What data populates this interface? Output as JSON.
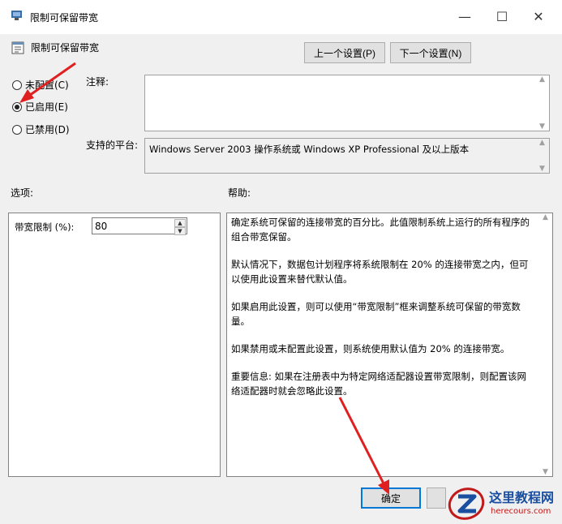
{
  "window": {
    "title": "限制可保留带宽",
    "minimize": "—",
    "maximize": "☐",
    "close": "✕"
  },
  "header": {
    "policy_title": "限制可保留带宽",
    "prev_label": "上一个设置(P)",
    "next_label": "下一个设置(N)"
  },
  "state": {
    "options": [
      {
        "label": "未配置(C)",
        "checked": false
      },
      {
        "label": "已启用(E)",
        "checked": true
      },
      {
        "label": "已禁用(D)",
        "checked": false
      }
    ]
  },
  "comment": {
    "label": "注释:",
    "value": ""
  },
  "platform": {
    "label": "支持的平台:",
    "value": "Windows Server 2003 操作系统或 Windows XP Professional 及以上版本"
  },
  "options_section": {
    "label": "选项:",
    "bandwidth_label": "带宽限制 (%):",
    "bandwidth_value": "80"
  },
  "help_section": {
    "label": "帮助:",
    "paragraphs": [
      "确定系统可保留的连接带宽的百分比。此值限制系统上运行的所有程序的组合带宽保留。",
      "默认情况下，数据包计划程序将系统限制在 20% 的连接带宽之内，但可以使用此设置来替代默认值。",
      "如果启用此设置，则可以使用“带宽限制”框来调整系统可保留的带宽数量。",
      "如果禁用或未配置此设置，则系统使用默认值为 20% 的连接带宽。",
      "重要信息: 如果在注册表中为特定网络适配器设置带宽限制，则配置该网络适配器时就会忽略此设置。"
    ]
  },
  "footer": {
    "ok_label": "确定"
  },
  "watermark": {
    "name": "这里教程网",
    "domain": "herecours.com"
  },
  "colors": {
    "accent": "#0078d7",
    "annotation_arrow": "#e02020"
  }
}
